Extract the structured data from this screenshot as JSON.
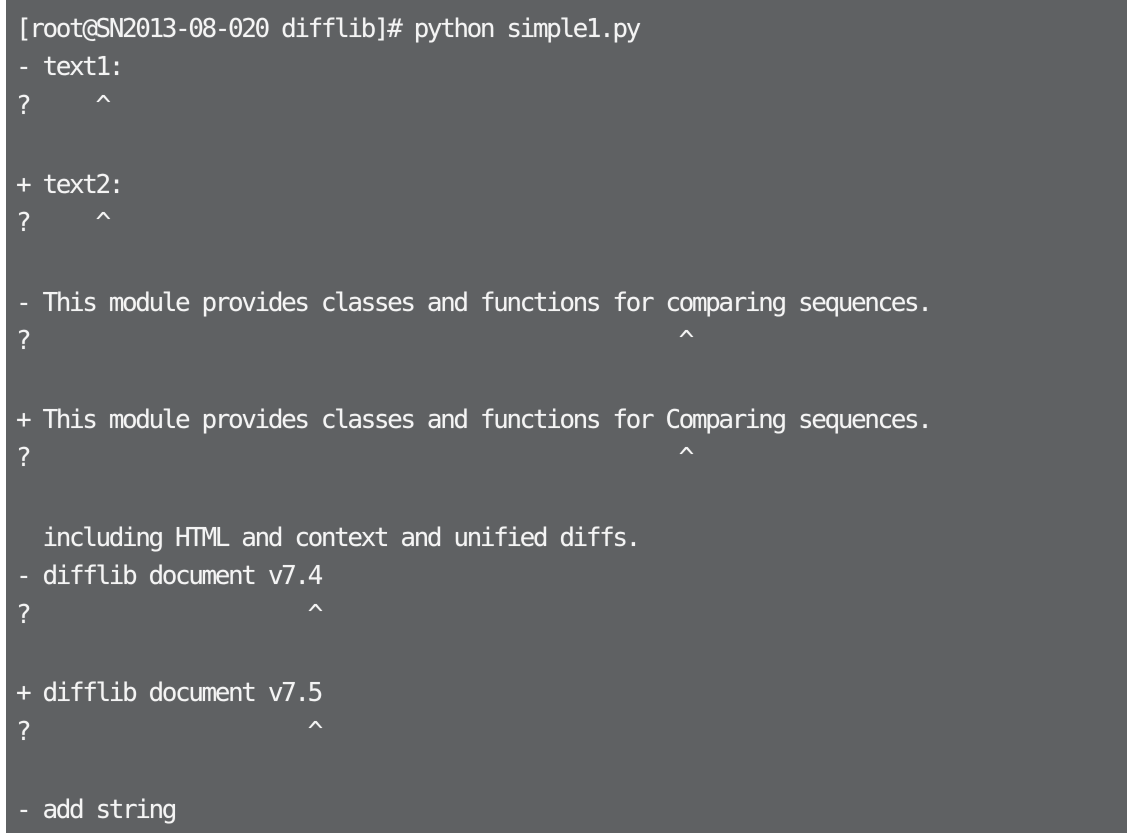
{
  "terminal": {
    "lines": [
      "[root@SN2013-08-020 difflib]# python simple1.py",
      "- text1:",
      "?     ^",
      "",
      "+ text2:",
      "?     ^",
      "",
      "- This module provides classes and functions for comparing sequences.",
      "?                                                 ^",
      "",
      "+ This module provides classes and functions for Comparing sequences.",
      "?                                                 ^",
      "",
      "  including HTML and context and unified diffs.",
      "- difflib document v7.4",
      "?                     ^",
      "",
      "+ difflib document v7.5",
      "?                     ^",
      "",
      "- add string"
    ]
  }
}
